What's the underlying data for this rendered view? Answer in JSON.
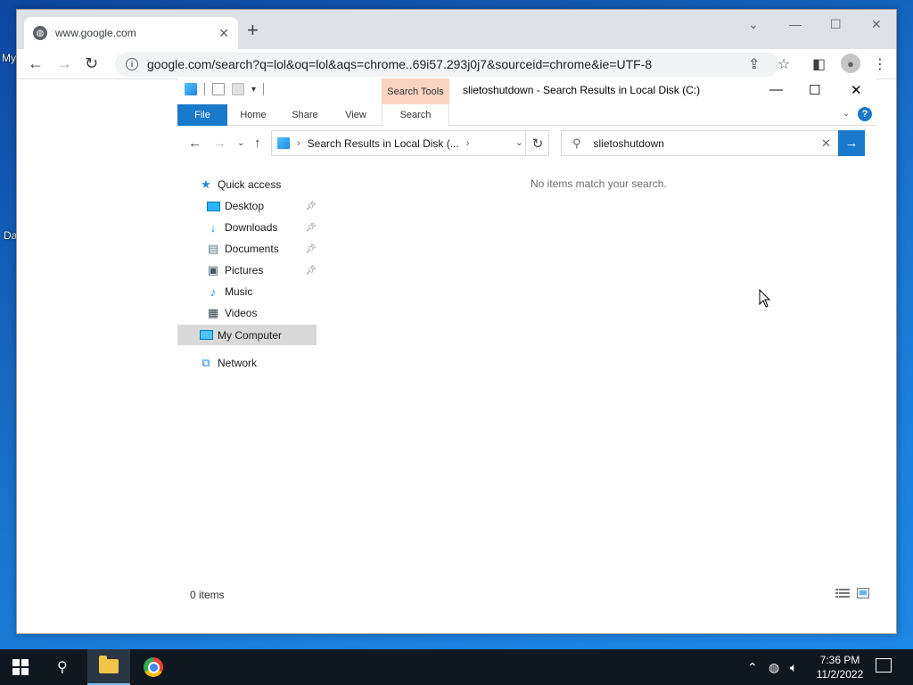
{
  "desktop": {
    "labels": [
      "My",
      "Da"
    ]
  },
  "chrome": {
    "tab_title": "www.google.com",
    "tab_close": "✕",
    "new_tab": "+",
    "url": "google.com/search?q=lol&oq=lol&aqs=chrome..69i57.293j0j7&sourceid=chrome&ie=UTF-8",
    "back": "←",
    "forward": "→",
    "reload": "↻"
  },
  "explorer": {
    "title": "slietoshutdown - Search Results in Local Disk (C:)",
    "context_tab": "Search Tools",
    "ribbon_tabs": [
      "File",
      "Home",
      "Share",
      "View",
      "Search"
    ],
    "address": "Search Results in Local Disk (...",
    "search_query": "slietoshutdown",
    "nav": {
      "quick_access": "Quick access",
      "desktop": "Desktop",
      "downloads": "Downloads",
      "documents": "Documents",
      "pictures": "Pictures",
      "music": "Music",
      "videos": "Videos",
      "my_computer": "My Computer",
      "network": "Network"
    },
    "empty_message": "No items match your search.",
    "status": "0 items"
  },
  "taskbar": {
    "time": "7:36 PM",
    "date": "11/2/2022"
  },
  "colors": {
    "accent": "#1979ca",
    "search_tools_ctx": "#fbd3c2",
    "selected_nav": "#d9d9d9"
  }
}
